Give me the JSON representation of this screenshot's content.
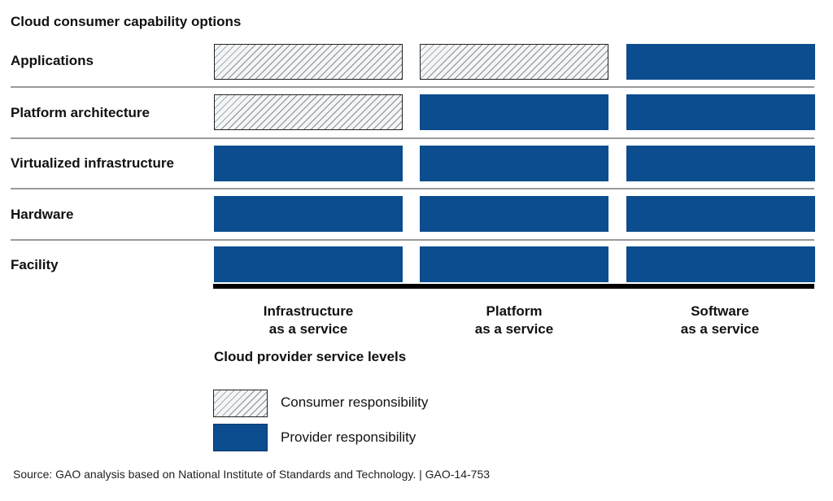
{
  "title": "Cloud consumer capability options",
  "colors": {
    "provider": "#0b4d8e",
    "consumer_hatch": "#8a8a8a",
    "baseline": "#000000",
    "separator": "#9a9a9a"
  },
  "columns": [
    {
      "line1": "Infrastructure",
      "line2": "as a service"
    },
    {
      "line1": "Platform",
      "line2": "as a service"
    },
    {
      "line1": "Software",
      "line2": "as a service"
    }
  ],
  "rows": [
    {
      "label": "Applications",
      "cells": [
        "consumer",
        "consumer",
        "provider"
      ]
    },
    {
      "label": "Platform architecture",
      "cells": [
        "consumer",
        "provider",
        "provider"
      ]
    },
    {
      "label": "Virtualized infrastructure",
      "cells": [
        "provider",
        "provider",
        "provider"
      ]
    },
    {
      "label": "Hardware",
      "cells": [
        "provider",
        "provider",
        "provider"
      ]
    },
    {
      "label": "Facility",
      "cells": [
        "provider",
        "provider",
        "provider"
      ]
    }
  ],
  "axis_title": "Cloud provider service levels",
  "legend": [
    {
      "key": "consumer",
      "label": "Consumer responsibility"
    },
    {
      "key": "provider",
      "label": "Provider responsibility"
    }
  ],
  "footer": "Source: GAO analysis based on National Institute of Standards and Technology.  |  GAO-14-753"
}
